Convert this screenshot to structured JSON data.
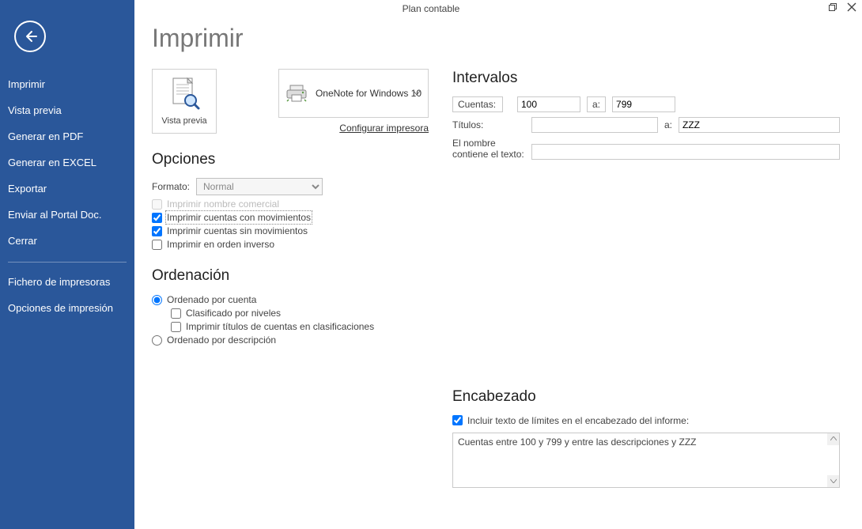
{
  "window": {
    "title": "Plan contable"
  },
  "sidebar": {
    "items": [
      {
        "label": "Imprimir"
      },
      {
        "label": "Vista previa"
      },
      {
        "label": "Generar en PDF"
      },
      {
        "label": "Generar en EXCEL"
      },
      {
        "label": "Exportar"
      },
      {
        "label": "Enviar al Portal Doc."
      },
      {
        "label": "Cerrar"
      }
    ],
    "items2": [
      {
        "label": "Fichero de impresoras"
      },
      {
        "label": "Opciones de impresión"
      }
    ]
  },
  "page": {
    "title": "Imprimir",
    "preview_label": "Vista previa",
    "printer_name": "OneNote for Windows 10",
    "configure_printer": "Configurar impresora"
  },
  "opciones": {
    "heading": "Opciones",
    "formato_label": "Formato:",
    "formato_value": "Normal",
    "chk_nombre_comercial": "Imprimir nombre comercial",
    "chk_con_mov": "Imprimir cuentas con movimientos",
    "chk_sin_mov": "Imprimir cuentas sin movimientos",
    "chk_inverso": "Imprimir en orden inverso"
  },
  "ordenacion": {
    "heading": "Ordenación",
    "radio_cuenta": "Ordenado por cuenta",
    "chk_niveles": "Clasificado por niveles",
    "chk_titulos": "Imprimir títulos de cuentas en clasificaciones",
    "radio_desc": "Ordenado por descripción"
  },
  "intervalos": {
    "heading": "Intervalos",
    "cuentas_label": "Cuentas:",
    "cuentas_from": "100",
    "cuentas_sep": "a:",
    "cuentas_to": "799",
    "titulos_label": "Títulos:",
    "titulos_from": "",
    "titulos_sep": "a:",
    "titulos_to": "ZZZ",
    "nombre_label_l1": "El nombre",
    "nombre_label_l2": "contiene el texto:",
    "nombre_value": ""
  },
  "encabezado": {
    "heading": "Encabezado",
    "chk_incluir": "Incluir texto de límites en el encabezado del informe:",
    "text": "Cuentas entre 100 y 799 y entre las descripciones  y ZZZ"
  }
}
